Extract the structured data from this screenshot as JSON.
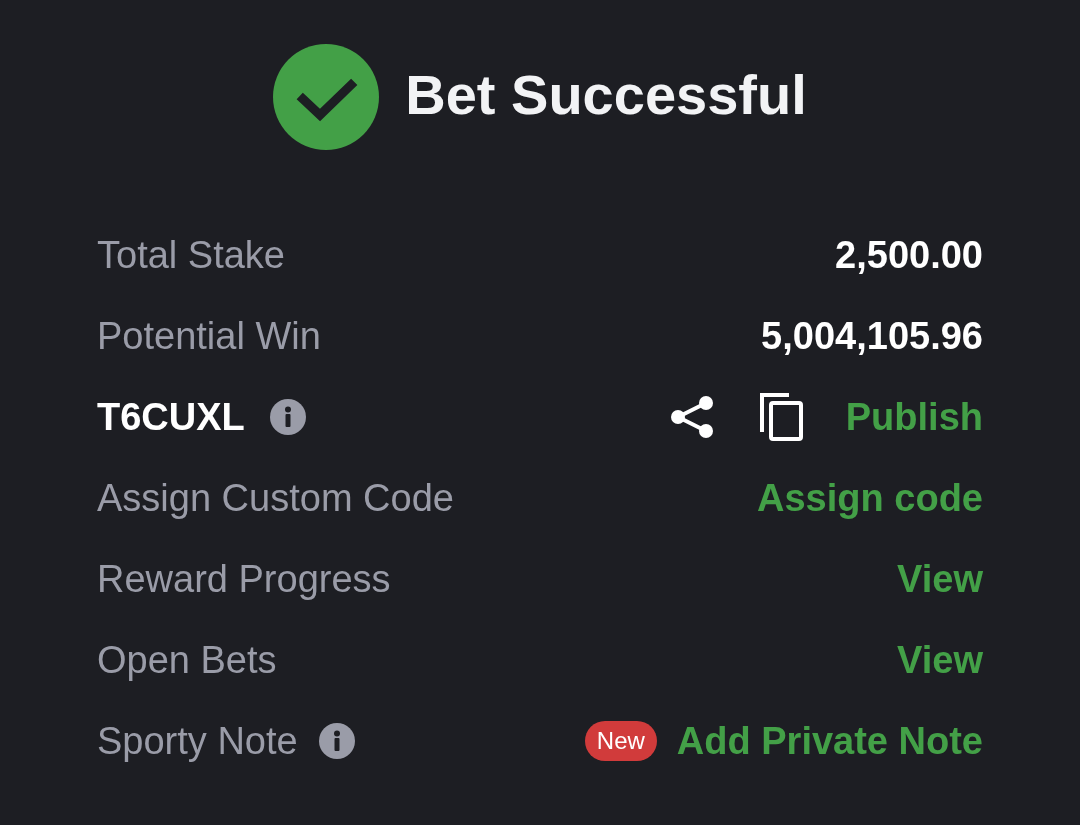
{
  "header": {
    "title": "Bet Successful"
  },
  "rows": [
    {
      "kind": "value",
      "label": "Total Stake",
      "value": "2,500.00"
    },
    {
      "kind": "value",
      "label": "Potential Win",
      "value": "5,004,105.96"
    },
    {
      "kind": "code",
      "code": "T6CUXL",
      "action": "Publish"
    },
    {
      "kind": "link",
      "label": "Assign Custom Code",
      "action": "Assign code"
    },
    {
      "kind": "link",
      "label": "Reward Progress",
      "action": "View"
    },
    {
      "kind": "link",
      "label": "Open Bets",
      "action": "View"
    },
    {
      "kind": "note",
      "label": "Sporty Note",
      "badge": "New",
      "action": "Add Private Note"
    }
  ]
}
